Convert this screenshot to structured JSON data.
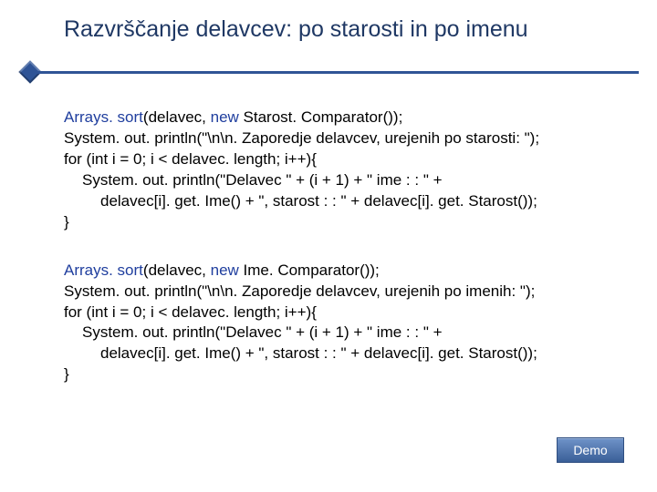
{
  "slide": {
    "title": "Razvrščanje delavcev: po starosti in po imenu",
    "demo_label": "Demo",
    "code1": {
      "l1a": "Arrays. sort",
      "l1b": "(delavec, ",
      "l1c": "new ",
      "l1d": "Starost. Comparator());",
      "l2": "System. out. println(\"\\n\\n. Zaporedje delavcev, urejenih po starosti: \");",
      "l3": "for (int i = 0; i < delavec. length; i++){",
      "l4": "System. out. println(\"Delavec \" + (i + 1) + \" ime : : \" +",
      "l5": "delavec[i]. get. Ime() + \", starost : : \" + delavec[i]. get. Starost());",
      "l6": "}"
    },
    "code2": {
      "l1a": "Arrays. sort",
      "l1b": "(delavec, ",
      "l1c": "new ",
      "l1d": "Ime. Comparator());",
      "l2": "System. out. println(\"\\n\\n. Zaporedje delavcev, urejenih po imenih: \");",
      "l3": "for (int i = 0; i < delavec. length; i++){",
      "l4": "System. out. println(\"Delavec \" + (i + 1) + \" ime : : \" +",
      "l5": "delavec[i]. get. Ime() + \", starost : : \" + delavec[i]. get. Starost());",
      "l6": "}"
    }
  }
}
